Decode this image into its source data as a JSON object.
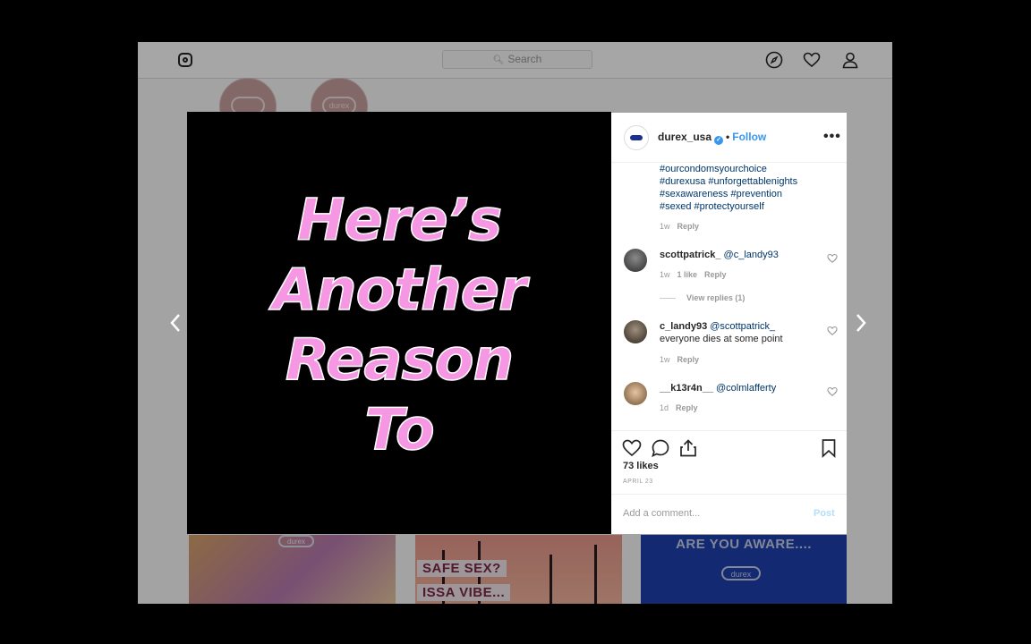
{
  "topbar": {
    "search_placeholder": "Search",
    "search_icon": "search-icon",
    "icons": [
      "instagram-logo-icon",
      "explore-compass-icon",
      "activity-heart-icon",
      "profile-icon"
    ]
  },
  "background_grid": {
    "aware_text": "ARE YOU AWARE....",
    "safe_sex_text": "SAFE SEX?",
    "issa_vibe_text": "ISSA VIBE...",
    "durex_text": "durex"
  },
  "media": {
    "headline_lines": [
      "Here’s",
      "Another",
      "Reason",
      "To"
    ],
    "headline_color": "#f597e2"
  },
  "post": {
    "username": "durex_usa",
    "separator": "•",
    "follow_label": "Follow",
    "more_label": "•••",
    "caption_hashtags": [
      "#ourcondomsyourchoice",
      "#durexusa #unforgettablenights",
      "#sexawareness #prevention",
      "#sexed #protectyourself"
    ],
    "caption_time": "1w",
    "caption_reply": "Reply",
    "comments": [
      {
        "user": "scottpatrick_",
        "mention": "@c_landy93",
        "text": "",
        "time": "1w",
        "likes": "1 like",
        "reply": "Reply",
        "view_replies": "View replies (1)"
      },
      {
        "user": "c_landy93",
        "mention": "@scottpatrick_",
        "text": "everyone dies at some point",
        "time": "1w",
        "reply": "Reply"
      },
      {
        "user": "__k13r4n__",
        "mention": "@colmlafferty",
        "text": "",
        "time": "1d",
        "reply": "Reply"
      }
    ],
    "likes": "73 likes",
    "date": "APRIL 23",
    "comment_placeholder": "Add a comment...",
    "post_label": "Post"
  },
  "colors": {
    "link": "#003569",
    "accent": "#3897f0",
    "post_disabled": "#b2dffc"
  }
}
